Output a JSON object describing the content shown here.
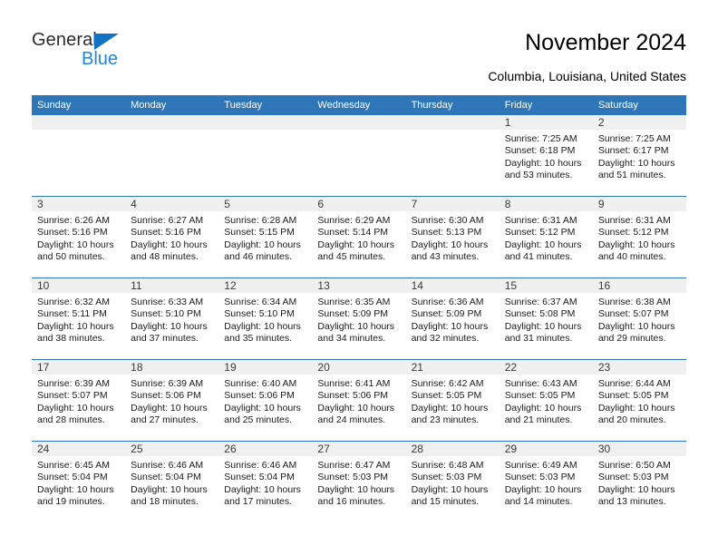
{
  "brand": {
    "name_part1": "General",
    "name_part2": "Blue",
    "accent_color": "#1e87d6",
    "triangle_color": "#1273c4"
  },
  "header": {
    "title": "November 2024",
    "subtitle": "Columbia, Louisiana, United States"
  },
  "theme": {
    "header_blue": "#2e76b8",
    "daynum_band": "#f0f0f0"
  },
  "weekday_headers": [
    "Sunday",
    "Monday",
    "Tuesday",
    "Wednesday",
    "Thursday",
    "Friday",
    "Saturday"
  ],
  "labels": {
    "sunrise_prefix": "Sunrise:",
    "sunset_prefix": "Sunset:",
    "daylight_prefix": "Daylight:"
  },
  "weeks": [
    [
      {
        "day": "",
        "empty": true
      },
      {
        "day": "",
        "empty": true
      },
      {
        "day": "",
        "empty": true
      },
      {
        "day": "",
        "empty": true
      },
      {
        "day": "",
        "empty": true
      },
      {
        "day": "1",
        "sunrise": "Sunrise: 7:25 AM",
        "sunset": "Sunset: 6:18 PM",
        "daylight_l1": "Daylight: 10 hours",
        "daylight_l2": "and 53 minutes."
      },
      {
        "day": "2",
        "sunrise": "Sunrise: 7:25 AM",
        "sunset": "Sunset: 6:17 PM",
        "daylight_l1": "Daylight: 10 hours",
        "daylight_l2": "and 51 minutes."
      }
    ],
    [
      {
        "day": "3",
        "sunrise": "Sunrise: 6:26 AM",
        "sunset": "Sunset: 5:16 PM",
        "daylight_l1": "Daylight: 10 hours",
        "daylight_l2": "and 50 minutes."
      },
      {
        "day": "4",
        "sunrise": "Sunrise: 6:27 AM",
        "sunset": "Sunset: 5:16 PM",
        "daylight_l1": "Daylight: 10 hours",
        "daylight_l2": "and 48 minutes."
      },
      {
        "day": "5",
        "sunrise": "Sunrise: 6:28 AM",
        "sunset": "Sunset: 5:15 PM",
        "daylight_l1": "Daylight: 10 hours",
        "daylight_l2": "and 46 minutes."
      },
      {
        "day": "6",
        "sunrise": "Sunrise: 6:29 AM",
        "sunset": "Sunset: 5:14 PM",
        "daylight_l1": "Daylight: 10 hours",
        "daylight_l2": "and 45 minutes."
      },
      {
        "day": "7",
        "sunrise": "Sunrise: 6:30 AM",
        "sunset": "Sunset: 5:13 PM",
        "daylight_l1": "Daylight: 10 hours",
        "daylight_l2": "and 43 minutes."
      },
      {
        "day": "8",
        "sunrise": "Sunrise: 6:31 AM",
        "sunset": "Sunset: 5:12 PM",
        "daylight_l1": "Daylight: 10 hours",
        "daylight_l2": "and 41 minutes."
      },
      {
        "day": "9",
        "sunrise": "Sunrise: 6:31 AM",
        "sunset": "Sunset: 5:12 PM",
        "daylight_l1": "Daylight: 10 hours",
        "daylight_l2": "and 40 minutes."
      }
    ],
    [
      {
        "day": "10",
        "sunrise": "Sunrise: 6:32 AM",
        "sunset": "Sunset: 5:11 PM",
        "daylight_l1": "Daylight: 10 hours",
        "daylight_l2": "and 38 minutes."
      },
      {
        "day": "11",
        "sunrise": "Sunrise: 6:33 AM",
        "sunset": "Sunset: 5:10 PM",
        "daylight_l1": "Daylight: 10 hours",
        "daylight_l2": "and 37 minutes."
      },
      {
        "day": "12",
        "sunrise": "Sunrise: 6:34 AM",
        "sunset": "Sunset: 5:10 PM",
        "daylight_l1": "Daylight: 10 hours",
        "daylight_l2": "and 35 minutes."
      },
      {
        "day": "13",
        "sunrise": "Sunrise: 6:35 AM",
        "sunset": "Sunset: 5:09 PM",
        "daylight_l1": "Daylight: 10 hours",
        "daylight_l2": "and 34 minutes."
      },
      {
        "day": "14",
        "sunrise": "Sunrise: 6:36 AM",
        "sunset": "Sunset: 5:09 PM",
        "daylight_l1": "Daylight: 10 hours",
        "daylight_l2": "and 32 minutes."
      },
      {
        "day": "15",
        "sunrise": "Sunrise: 6:37 AM",
        "sunset": "Sunset: 5:08 PM",
        "daylight_l1": "Daylight: 10 hours",
        "daylight_l2": "and 31 minutes."
      },
      {
        "day": "16",
        "sunrise": "Sunrise: 6:38 AM",
        "sunset": "Sunset: 5:07 PM",
        "daylight_l1": "Daylight: 10 hours",
        "daylight_l2": "and 29 minutes."
      }
    ],
    [
      {
        "day": "17",
        "sunrise": "Sunrise: 6:39 AM",
        "sunset": "Sunset: 5:07 PM",
        "daylight_l1": "Daylight: 10 hours",
        "daylight_l2": "and 28 minutes."
      },
      {
        "day": "18",
        "sunrise": "Sunrise: 6:39 AM",
        "sunset": "Sunset: 5:06 PM",
        "daylight_l1": "Daylight: 10 hours",
        "daylight_l2": "and 27 minutes."
      },
      {
        "day": "19",
        "sunrise": "Sunrise: 6:40 AM",
        "sunset": "Sunset: 5:06 PM",
        "daylight_l1": "Daylight: 10 hours",
        "daylight_l2": "and 25 minutes."
      },
      {
        "day": "20",
        "sunrise": "Sunrise: 6:41 AM",
        "sunset": "Sunset: 5:06 PM",
        "daylight_l1": "Daylight: 10 hours",
        "daylight_l2": "and 24 minutes."
      },
      {
        "day": "21",
        "sunrise": "Sunrise: 6:42 AM",
        "sunset": "Sunset: 5:05 PM",
        "daylight_l1": "Daylight: 10 hours",
        "daylight_l2": "and 23 minutes."
      },
      {
        "day": "22",
        "sunrise": "Sunrise: 6:43 AM",
        "sunset": "Sunset: 5:05 PM",
        "daylight_l1": "Daylight: 10 hours",
        "daylight_l2": "and 21 minutes."
      },
      {
        "day": "23",
        "sunrise": "Sunrise: 6:44 AM",
        "sunset": "Sunset: 5:05 PM",
        "daylight_l1": "Daylight: 10 hours",
        "daylight_l2": "and 20 minutes."
      }
    ],
    [
      {
        "day": "24",
        "sunrise": "Sunrise: 6:45 AM",
        "sunset": "Sunset: 5:04 PM",
        "daylight_l1": "Daylight: 10 hours",
        "daylight_l2": "and 19 minutes."
      },
      {
        "day": "25",
        "sunrise": "Sunrise: 6:46 AM",
        "sunset": "Sunset: 5:04 PM",
        "daylight_l1": "Daylight: 10 hours",
        "daylight_l2": "and 18 minutes."
      },
      {
        "day": "26",
        "sunrise": "Sunrise: 6:46 AM",
        "sunset": "Sunset: 5:04 PM",
        "daylight_l1": "Daylight: 10 hours",
        "daylight_l2": "and 17 minutes."
      },
      {
        "day": "27",
        "sunrise": "Sunrise: 6:47 AM",
        "sunset": "Sunset: 5:03 PM",
        "daylight_l1": "Daylight: 10 hours",
        "daylight_l2": "and 16 minutes."
      },
      {
        "day": "28",
        "sunrise": "Sunrise: 6:48 AM",
        "sunset": "Sunset: 5:03 PM",
        "daylight_l1": "Daylight: 10 hours",
        "daylight_l2": "and 15 minutes."
      },
      {
        "day": "29",
        "sunrise": "Sunrise: 6:49 AM",
        "sunset": "Sunset: 5:03 PM",
        "daylight_l1": "Daylight: 10 hours",
        "daylight_l2": "and 14 minutes."
      },
      {
        "day": "30",
        "sunrise": "Sunrise: 6:50 AM",
        "sunset": "Sunset: 5:03 PM",
        "daylight_l1": "Daylight: 10 hours",
        "daylight_l2": "and 13 minutes."
      }
    ]
  ]
}
